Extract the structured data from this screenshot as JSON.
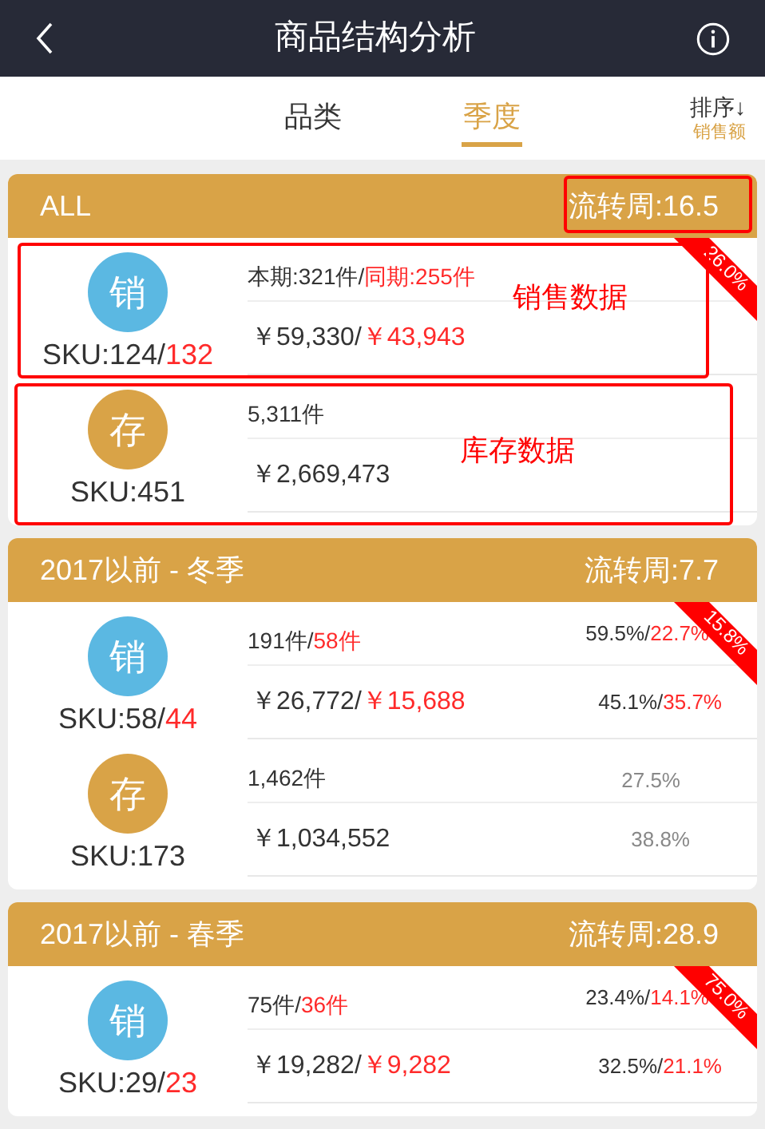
{
  "header": {
    "title": "商品结构分析"
  },
  "tabs": [
    {
      "label": "品类",
      "selected": false
    },
    {
      "label": "季度",
      "selected": true
    }
  ],
  "sort": {
    "label": "排序↓",
    "value": "销售额"
  },
  "sections": [
    {
      "title": "ALL",
      "turnover": "流转周:16.5",
      "ribbon": "26.0%",
      "sales": {
        "badge": "销",
        "sku": "SKU:124/",
        "sku_prior": "132",
        "qty": "本期:321件/",
        "qty_prior": "同期:255件",
        "amount": "￥59,330/",
        "amount_prior": "￥43,943"
      },
      "stock": {
        "badge": "存",
        "sku": "SKU:451",
        "qty": "5,311件",
        "amount": "￥2,669,473"
      },
      "annotations": [
        {
          "kind": "turnover_box"
        },
        {
          "kind": "sales_box",
          "label": "销售数据"
        },
        {
          "kind": "stock_box",
          "label": "库存数据"
        }
      ]
    },
    {
      "title": "2017以前 - 冬季",
      "turnover": "流转周:7.7",
      "ribbon": "15.8%",
      "sales": {
        "badge": "销",
        "sku": "SKU:58/",
        "sku_prior": "44",
        "qty": "191件/",
        "qty_prior": "58件",
        "amount": "￥26,772/",
        "amount_prior": "￥15,688",
        "qty_share": "59.5%/",
        "qty_share_prior": "22.7%",
        "amount_share": "45.1%/",
        "amount_share_prior": "35.7%"
      },
      "stock": {
        "badge": "存",
        "sku": "SKU:173",
        "qty": "1,462件",
        "amount": "￥1,034,552",
        "qty_share": "27.5%",
        "amount_share": "38.8%"
      }
    },
    {
      "title": "2017以前 - 春季",
      "turnover": "流转周:28.9",
      "ribbon": "75.0%",
      "sales": {
        "badge": "销",
        "sku": "SKU:29/",
        "sku_prior": "23",
        "qty": "75件/",
        "qty_prior": "36件",
        "amount": "￥19,282/",
        "amount_prior": "￥9,282",
        "qty_share": "23.4%/",
        "qty_share_prior": "14.1%",
        "amount_share": "32.5%/",
        "amount_share_prior": "21.1%"
      }
    }
  ]
}
